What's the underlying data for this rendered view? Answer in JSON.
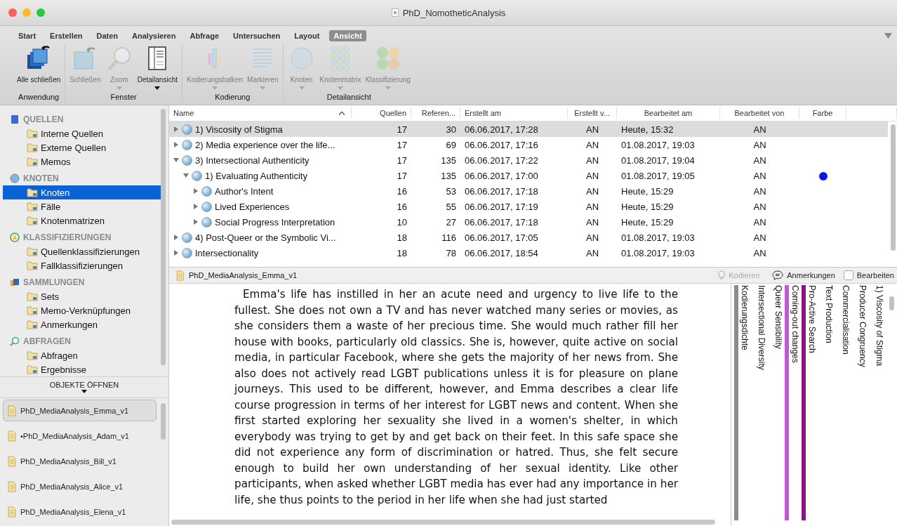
{
  "window": {
    "title": "PhD_NomotheticAnalysis"
  },
  "ribbon_tabs": [
    {
      "label": "Start",
      "selected": false
    },
    {
      "label": "Erstellen",
      "selected": false
    },
    {
      "label": "Daten",
      "selected": false
    },
    {
      "label": "Analysieren",
      "selected": false
    },
    {
      "label": "Abfrage",
      "selected": false
    },
    {
      "label": "Untersuchen",
      "selected": false
    },
    {
      "label": "Layout",
      "selected": false
    },
    {
      "label": "Ansicht",
      "selected": true
    }
  ],
  "ribbon_groups": [
    {
      "label": "Anwendung",
      "tools": [
        {
          "label": "Alle schließen",
          "disabled": false,
          "dropdown": false
        }
      ]
    },
    {
      "label": "Fenster",
      "tools": [
        {
          "label": "Schließen",
          "disabled": true,
          "dropdown": false
        },
        {
          "label": "Zoom",
          "disabled": true,
          "dropdown": true
        },
        {
          "label": "Detailansicht",
          "disabled": false,
          "dropdown": true
        }
      ]
    },
    {
      "label": "Kodierung",
      "tools": [
        {
          "label": "Kodierungsbalken",
          "disabled": true,
          "dropdown": true
        },
        {
          "label": "Markieren",
          "disabled": true,
          "dropdown": true
        }
      ]
    },
    {
      "label": "Detailansicht",
      "tools": [
        {
          "label": "Knoten",
          "disabled": true,
          "dropdown": true
        },
        {
          "label": "Knotenmatrix",
          "disabled": true,
          "dropdown": true
        },
        {
          "label": "Klassifizierung",
          "disabled": true,
          "dropdown": true
        }
      ]
    }
  ],
  "sidebar": {
    "sections": [
      {
        "label": "QUELLEN",
        "items": [
          {
            "label": "Interne Quellen",
            "selected": false
          },
          {
            "label": "Externe Quellen",
            "selected": false
          },
          {
            "label": "Memos",
            "selected": false
          }
        ]
      },
      {
        "label": "KNOTEN",
        "items": [
          {
            "label": "Knoten",
            "selected": true
          },
          {
            "label": "Fälle",
            "selected": false
          },
          {
            "label": "Knotenmatrizen",
            "selected": false
          }
        ]
      },
      {
        "label": "KLASSIFIZIERUNGEN",
        "items": [
          {
            "label": "Quellenklassifizierungen",
            "selected": false
          },
          {
            "label": "Fallklassifizierungen",
            "selected": false
          }
        ]
      },
      {
        "label": "SAMMLUNGEN",
        "items": [
          {
            "label": "Sets",
            "selected": false
          },
          {
            "label": "Memo-Verknüpfungen",
            "selected": false
          },
          {
            "label": "Anmerkungen",
            "selected": false
          }
        ]
      },
      {
        "label": "ABFRAGEN",
        "items": [
          {
            "label": "Abfragen",
            "selected": false
          },
          {
            "label": "Ergebnisse",
            "selected": false
          }
        ]
      }
    ],
    "open_objects": {
      "title": "OBJEKTE ÖFFNEN",
      "items": [
        {
          "label": "PhD_MediaAnalysis_Emma_v1",
          "selected": true
        },
        {
          "label": "•PhD_MediaAnalysis_Adam_v1",
          "selected": false
        },
        {
          "label": "PhD_MediaAnalysis_Bill_v1",
          "selected": false
        },
        {
          "label": "PhD_MediaAnalysis_Alice_v1",
          "selected": false
        },
        {
          "label": "PhD_MediaAnalysis_Elena_v1",
          "selected": false
        }
      ]
    }
  },
  "table": {
    "columns": [
      "Name",
      "Quellen",
      "Referen...",
      "Erstellt am",
      "Erstellt v...",
      "Bearbeitet am",
      "Bearbeitet von",
      "Farbe"
    ],
    "rows": [
      {
        "name": "1) Viscosity of Stigma",
        "sources": "17",
        "references": "30",
        "created": "06.06.2017, 17:28",
        "created_by": "AN",
        "modified": "Heute, 15:32",
        "modified_by": "AN",
        "selected": true,
        "expanded": false
      },
      {
        "name": "2) Media experience over the life...",
        "sources": "17",
        "references": "69",
        "created": "06.06.2017, 17:16",
        "created_by": "AN",
        "modified": "01.08.2017, 19:03",
        "modified_by": "AN",
        "selected": false,
        "expanded": false
      },
      {
        "name": "3) Intersectional Authenticity",
        "sources": "17",
        "references": "135",
        "created": "06.06.2017, 17:22",
        "created_by": "AN",
        "modified": "01.08.2017, 19:04",
        "modified_by": "AN",
        "selected": false,
        "expanded": true,
        "children": [
          {
            "name": "1) Evaluating Authenticity",
            "sources": "17",
            "references": "135",
            "created": "06.06.2017, 17:00",
            "created_by": "AN",
            "modified": "01.08.2017, 19:05",
            "modified_by": "AN",
            "selected": false,
            "expanded": true,
            "color": "#0a14e6",
            "children": [
              {
                "name": "Author's Intent",
                "sources": "16",
                "references": "53",
                "created": "06.06.2017, 17:18",
                "created_by": "AN",
                "modified": "Heute, 15:29",
                "modified_by": "AN",
                "selected": false,
                "expanded": false
              },
              {
                "name": "Lived Experiences",
                "sources": "16",
                "references": "55",
                "created": "06.06.2017, 17:19",
                "created_by": "AN",
                "modified": "Heute, 15:29",
                "modified_by": "AN",
                "selected": false,
                "expanded": false
              },
              {
                "name": "Social Progress Interpretation",
                "sources": "10",
                "references": "27",
                "created": "06.06.2017, 17:18",
                "created_by": "AN",
                "modified": "Heute, 15:29",
                "modified_by": "AN",
                "selected": false,
                "expanded": false
              }
            ]
          }
        ]
      },
      {
        "name": "4) Post-Queer or the Symbolic Vi...",
        "sources": "18",
        "references": "116",
        "created": "06.06.2017, 17:05",
        "created_by": "AN",
        "modified": "01.08.2017, 19:03",
        "modified_by": "AN",
        "selected": false,
        "expanded": false
      },
      {
        "name": "Intersectionality",
        "sources": "18",
        "references": "78",
        "created": "06.06.2017, 18:54",
        "created_by": "AN",
        "modified": "01.08.2017, 19:03",
        "modified_by": "AN",
        "selected": false,
        "expanded": false
      }
    ]
  },
  "document": {
    "title": "PhD_MediaAnalysis_Emma_v1",
    "code_button": {
      "label": "Kodieren",
      "disabled": true
    },
    "annotations_button": {
      "label": "Anmerkungen"
    },
    "edit_checkbox": {
      "label": "Bearbeiten",
      "checked": false
    },
    "text": "Emma's life has instilled in her an acute need and urgency to live life to the fullest. She does not own a TV and has never watched many series or movies, as she considers them a waste of her precious time. She would much rather fill her house with books, particularly old classics. She is, however, quite active on social media, in particular Facebook, where she gets the majority of her news from. She also does not actively read LGBT publications unless it is for pleasure on plane journeys. This used to be different, however, and Emma describes a clear life course progression in terms of her interest for LGBT news and content. When she first started exploring her sexuality she lived in a women's shelter, in which everybody was trying to get by and get back on their feet. In this safe space she did not experience any form of discrimination or hatred. Thus, she felt secure enough to build her own understanding of her sexual identity. Like other participants, when asked whether LGBT media has ever had any importance in her life, she thus points to the period in her life when she had just started",
    "coding_stripes": [
      {
        "label": "Kodierungsdichte",
        "color": "#8c8c8c"
      },
      {
        "label": "Intersectional Diversity"
      },
      {
        "label": "Queer Sensibility"
      },
      {
        "label": "Coming-out changes",
        "color": "#c05ad6"
      },
      {
        "label": "Pro-Active Search",
        "color": "#8a1488"
      },
      {
        "label": "Text Production"
      },
      {
        "label": "Commercialisation"
      },
      {
        "label": "Producer Congruency"
      },
      {
        "label": "1) Viscosity of Stigma"
      }
    ]
  }
}
